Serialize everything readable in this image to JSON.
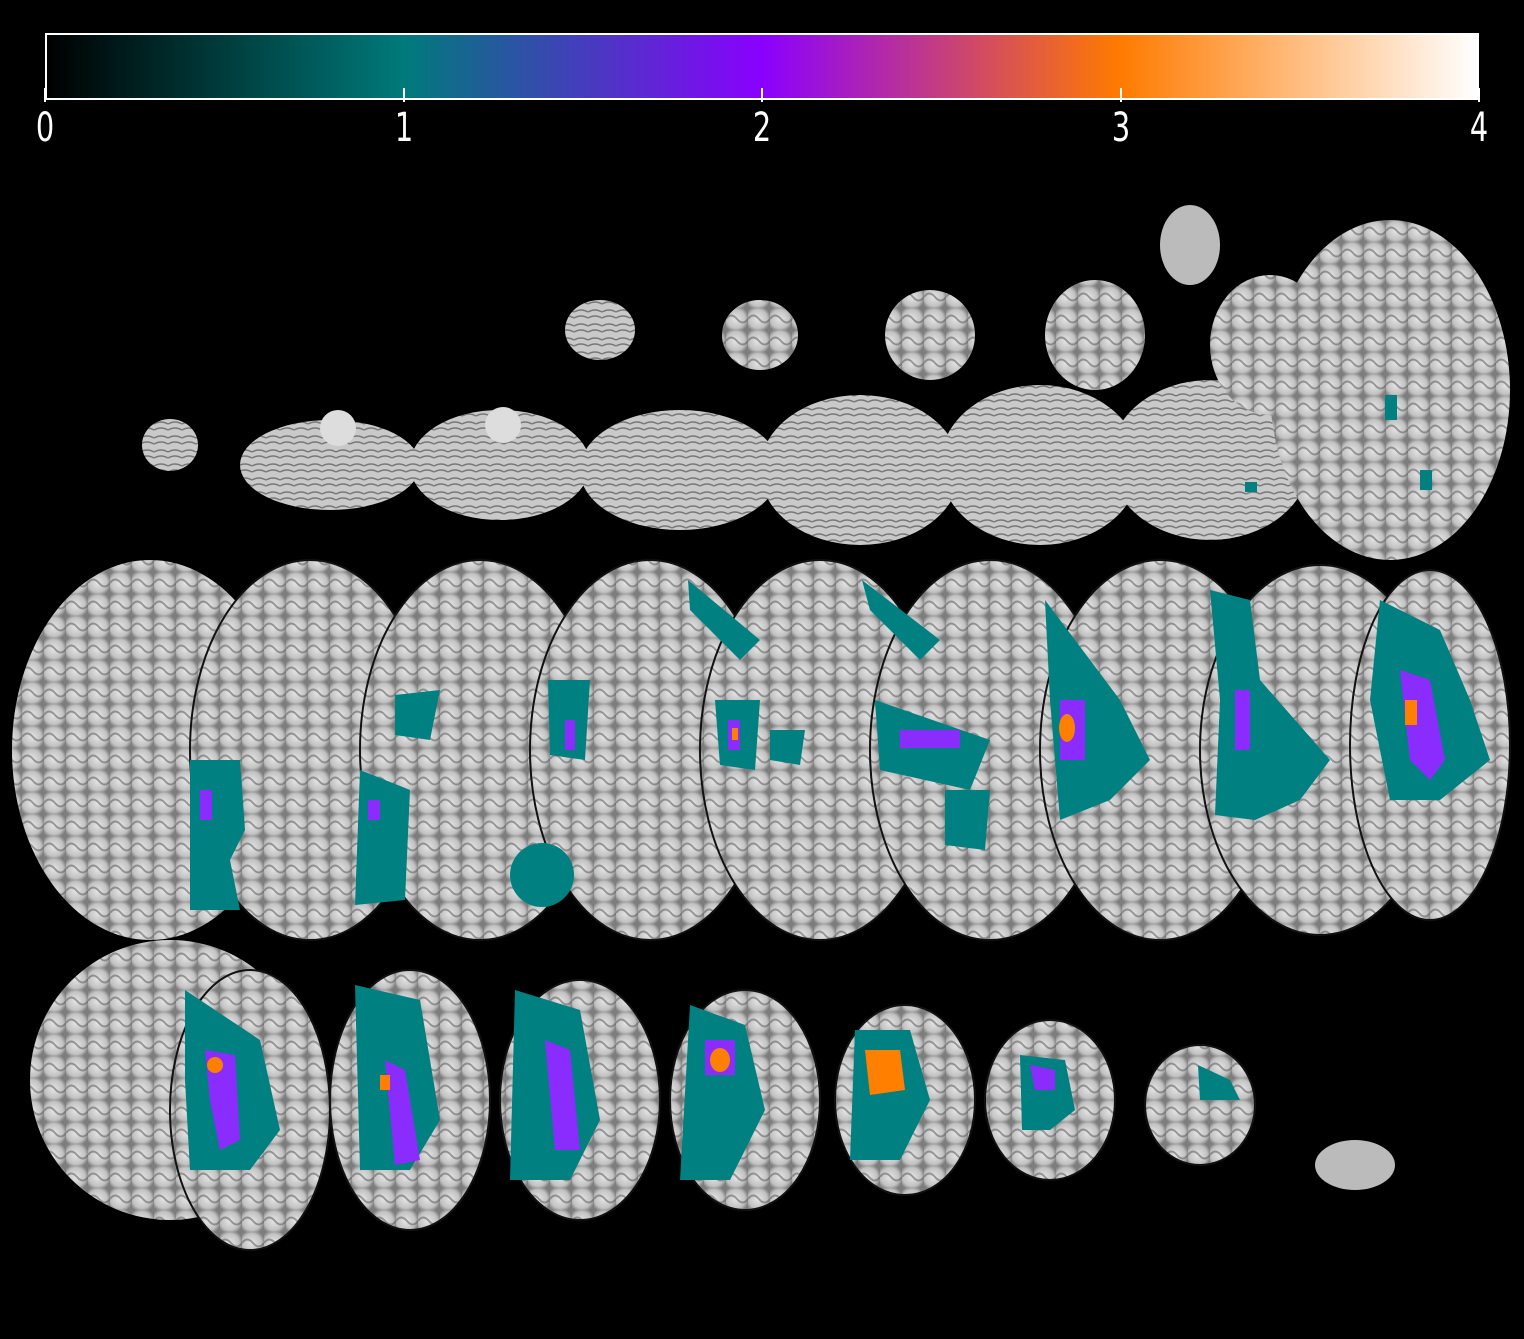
{
  "colorbar": {
    "ticks": [
      "0",
      "1",
      "2",
      "3",
      "4"
    ],
    "range": [
      0,
      4
    ],
    "gradient": [
      "#000000",
      "#007a7a",
      "#8a00ff",
      "#ff7a00",
      "#ffffff"
    ]
  },
  "overlay_colors": {
    "teal": "#008080",
    "violet": "#8b2cff",
    "orange": "#ff7f00"
  },
  "montage": {
    "view": "axial",
    "rows": 3
  }
}
